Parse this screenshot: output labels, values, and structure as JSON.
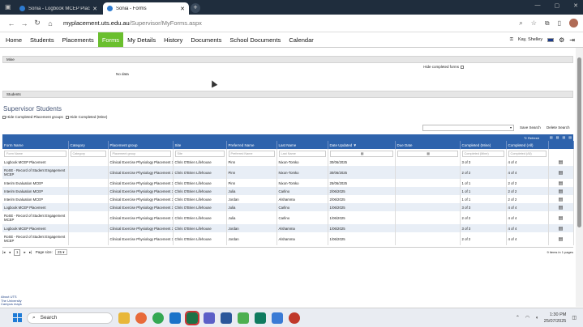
{
  "browser": {
    "tabs": [
      {
        "title": "Sonia - Logbook MCEP Placement",
        "active": false
      },
      {
        "title": "Sonia - Forms",
        "active": true
      }
    ],
    "url_host": "myplacement.uts.edu.au",
    "url_path": "/Supervisor/MyForms.aspx"
  },
  "nav": {
    "items": [
      "Home",
      "Students",
      "Placements",
      "Forms",
      "My Details",
      "History",
      "Documents",
      "School Documents",
      "Calendar"
    ],
    "active": "Forms",
    "user": "Kay, Shelley"
  },
  "mine": {
    "header": "Mine",
    "no_data": "No data",
    "hide_completed": "Hide completed forms"
  },
  "students": {
    "header": "Students",
    "title": "Supervisor Students",
    "filter1": "Hide Completed Placement groups",
    "filter2": "Hide Completed (Mine)",
    "save_search": "Save Search",
    "delete_search": "Delete Search",
    "refresh": "Refresh"
  },
  "table": {
    "columns": [
      "Form Name",
      "Category",
      "Placement group",
      "Site",
      "Preferred Name",
      "Last Name",
      "Date Updated",
      "Due Date",
      "Completed (Mine)",
      "Completed (All)"
    ],
    "filter_placeholders": [
      "Form Name",
      "Category",
      "Placement group",
      "Site",
      "Preferred Name",
      "Last Name",
      "",
      "",
      "Completed (Mine)",
      "Completed (All)"
    ],
    "rows": [
      [
        "Logbook MCEP Placement",
        "",
        "Clinical Exercise Physiology Placement 3",
        "Chris O'Brien Lifehouse",
        "Pinn",
        "Nixon-Tomko",
        "30/06/2025",
        "",
        "3 of 3",
        "4 of 4"
      ],
      [
        "RoSE - Record of Student Engagement MCEP",
        "",
        "Clinical Exercise Physiology Placement 3",
        "Chris O'Brien Lifehouse",
        "Pinn",
        "Nixon-Tomko",
        "30/06/2025",
        "",
        "2 of 2",
        "4 of 4"
      ],
      [
        "Interim Evaluation MCEP",
        "",
        "Clinical Exercise Physiology Placement 3",
        "Chris O'Brien Lifehouse",
        "Pinn",
        "Nixon-Tomko",
        "25/06/2025",
        "",
        "1 of 1",
        "2 of 2"
      ],
      [
        "Interim Evaluation MCEP",
        "",
        "Clinical Exercise Physiology Placement 3",
        "Chris O'Brien Lifehouse",
        "Julia",
        "Carlino",
        "2/06/2025",
        "",
        "1 of 1",
        "2 of 2"
      ],
      [
        "Interim Evaluation MCEP",
        "",
        "Clinical Exercise Physiology Placement 3",
        "Chris O'Brien Lifehouse",
        "Jordan",
        "Alshamma",
        "2/06/2025",
        "",
        "1 of 1",
        "2 of 2"
      ],
      [
        "Logbook MCEP Placement",
        "",
        "Clinical Exercise Physiology Placement 3",
        "Chris O'Brien Lifehouse",
        "Julia",
        "Carlino",
        "1/06/2025",
        "",
        "3 of 3",
        "4 of 4"
      ],
      [
        "RoSE - Record of Student Engagement MCEP",
        "",
        "Clinical Exercise Physiology Placement 3",
        "Chris O'Brien Lifehouse",
        "Julia",
        "Carlino",
        "1/06/2025",
        "",
        "2 of 2",
        "4 of 4"
      ],
      [
        "Logbook MCEP Placement",
        "",
        "Clinical Exercise Physiology Placement 3",
        "Chris O'Brien Lifehouse",
        "Jordan",
        "Alshamma",
        "1/06/2025",
        "",
        "3 of 3",
        "4 of 4"
      ],
      [
        "RoSE - Record of Student Engagement MCEP",
        "",
        "Clinical Exercise Physiology Placement 3",
        "Chris O'Brien Lifehouse",
        "Jordan",
        "Alshamma",
        "1/06/2025",
        "",
        "2 of 2",
        "4 of 4"
      ]
    ]
  },
  "pager": {
    "current_page": "1",
    "page_size_label": "Page size:",
    "page_size": "25",
    "items_summary": "9 items in 1 pages"
  },
  "footer": {
    "line1": "About UTS",
    "line2": "The University",
    "line3": "Campus maps"
  },
  "taskbar": {
    "search": "Search",
    "time": "1:30 PM",
    "date": "25/07/2025"
  }
}
